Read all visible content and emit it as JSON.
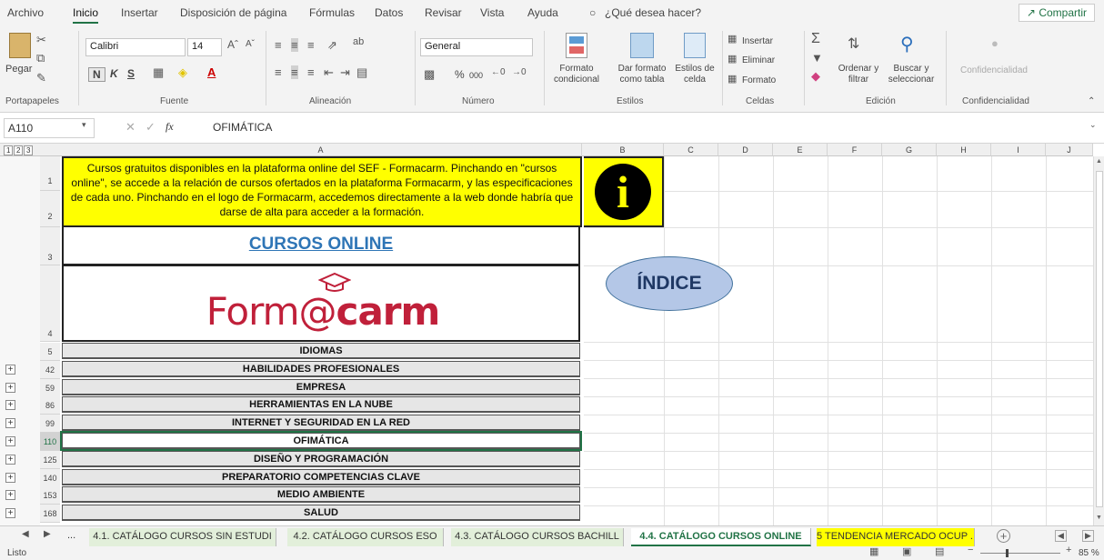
{
  "menu": {
    "items": [
      "Archivo",
      "Inicio",
      "Insertar",
      "Disposición de página",
      "Fórmulas",
      "Datos",
      "Revisar",
      "Vista",
      "Ayuda"
    ],
    "tell_me": "¿Qué desea hacer?",
    "share": "Compartir"
  },
  "ribbon": {
    "clipboard": {
      "paste": "Pegar",
      "label": "Portapapeles"
    },
    "font": {
      "name": "Calibri",
      "size": "14",
      "bold": "N",
      "italic": "K",
      "underline": "S",
      "label": "Fuente"
    },
    "alignment": {
      "label": "Alineación"
    },
    "number": {
      "format": "General",
      "percent": "%",
      "thousands": "000",
      "label": "Número"
    },
    "styles": {
      "conditional": "Formato condicional",
      "table": "Dar formato como tabla",
      "cell": "Estilos de celda",
      "label": "Estilos"
    },
    "cells": {
      "insert": "Insertar",
      "delete": "Eliminar",
      "format": "Formato",
      "label": "Celdas"
    },
    "editing": {
      "sort": "Ordenar y filtrar",
      "find": "Buscar y seleccionar",
      "label": "Edición"
    },
    "confidentiality": {
      "button": "Confidencialidad",
      "label": "Confidencialidad"
    }
  },
  "formula_bar": {
    "name_box": "A110",
    "fx": "fx",
    "value": "OFIMÁTICA"
  },
  "columns": [
    "A",
    "B",
    "C",
    "D",
    "E",
    "F",
    "G",
    "H",
    "I",
    "J"
  ],
  "outline_levels": [
    "1",
    "2",
    "3"
  ],
  "sheet": {
    "info_text": "Cursos gratuitos disponibles en la plataforma online del SEF - Formacarm. Pinchando en \"cursos online\", se accede a la relación de cursos ofertados en la plataforma Formacarm, y las especificaciones de cada uno.  Pinchando en el logo de Formacarm, accedemos directamente a la web donde habría que darse de alta para acceder a la formación.",
    "title": "CURSOS ONLINE",
    "logo_part1": "Form",
    "logo_at": "@",
    "logo_part2": "carm",
    "index_button": "ÍNDICE",
    "info_icon": "i",
    "top_rows": [
      "1",
      "2",
      "3",
      "4"
    ],
    "categories": [
      {
        "row": "5",
        "label": "IDIOMAS"
      },
      {
        "row": "42",
        "label": "HABILIDADES PROFESIONALES"
      },
      {
        "row": "59",
        "label": "EMPRESA"
      },
      {
        "row": "86",
        "label": "HERRAMIENTAS EN LA NUBE"
      },
      {
        "row": "99",
        "label": "INTERNET Y SEGURIDAD EN LA RED"
      },
      {
        "row": "110",
        "label": "OFIMÁTICA"
      },
      {
        "row": "125",
        "label": "DISEÑO Y PROGRAMACIÓN"
      },
      {
        "row": "140",
        "label": "PREPARATORIO COMPETENCIAS CLAVE"
      },
      {
        "row": "153",
        "label": "MEDIO AMBIENTE"
      },
      {
        "row": "168",
        "label": "SALUD"
      }
    ]
  },
  "tabs": {
    "ellipsis": "...",
    "items": [
      "4.1. CATÁLOGO CURSOS SIN ESTUDI",
      "4.2. CATÁLOGO CURSOS ESO",
      "4.3. CATÁLOGO CURSOS BACHILL",
      "4.4. CATÁLOGO CURSOS ONLINE",
      "5 TENDENCIA MERCADO OCUP ..."
    ],
    "add": "+"
  },
  "status": {
    "mode": "Listo",
    "zoom": "85 %"
  },
  "colors": {
    "accent": "#217346",
    "info_yellow": "#ffff00",
    "index_oval": "#b4c7e7",
    "title_blue": "#2e75b6",
    "logo_red": "#c0203a"
  }
}
